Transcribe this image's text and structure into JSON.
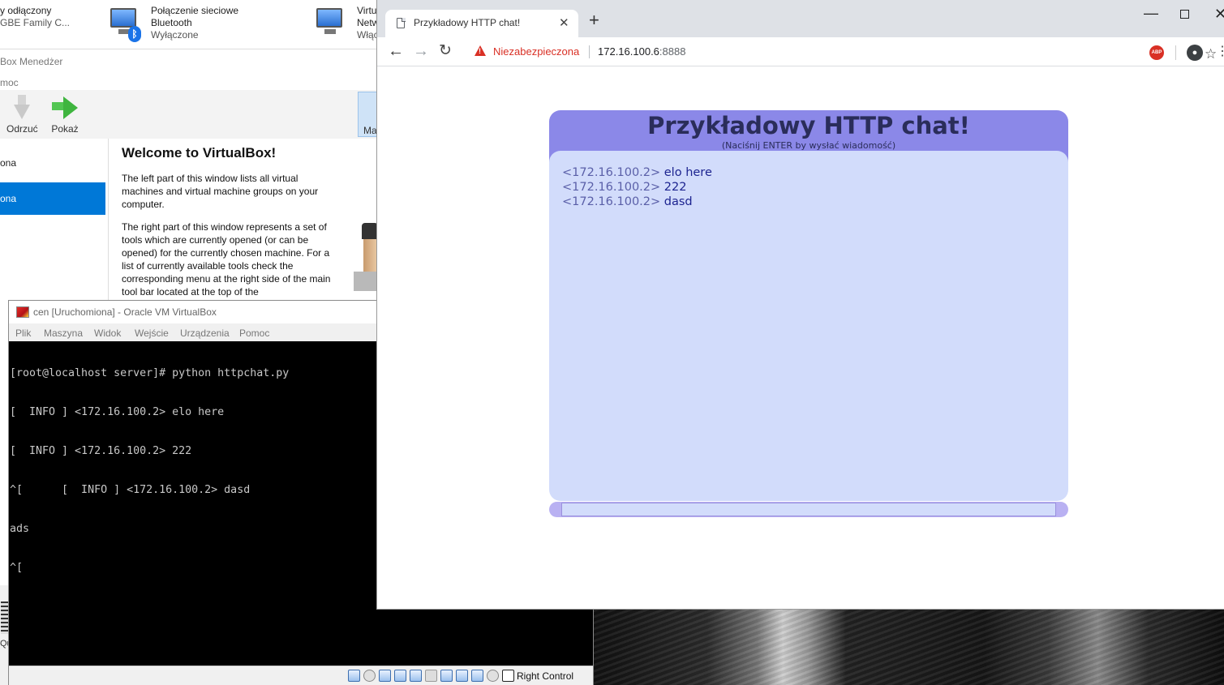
{
  "desktop": {
    "left_edge_label": "Qu"
  },
  "network_connections": {
    "items": [
      {
        "name": "y odłączony",
        "sub": "GBE Family C..."
      },
      {
        "name": "Połączenie sieciowe",
        "name2": "Bluetooth",
        "sub": "Wyłączone"
      },
      {
        "name": "Virtu",
        "name2": "Netw",
        "sub": "Włąc"
      }
    ]
  },
  "vbox_manager": {
    "title": "Box Menedżer",
    "menu_fragment": "moc",
    "toolbar": {
      "discard_label": "Odrzuć",
      "show_label": "Pokaż",
      "machine_tab": "Ma"
    },
    "vm_list": [
      {
        "label": "ona"
      },
      {
        "label": "ona"
      }
    ],
    "welcome": {
      "heading": "Welcome to VirtualBox!",
      "p1": "The left part of this window lists all virtual machines and virtual machine groups on your computer.",
      "p2": "The right part of this window represents a set of tools which are currently opened (or can be opened) for the currently chosen machine. For a list of currently available tools check the corresponding menu at the right side of the main tool bar located at the top of the"
    }
  },
  "vm_window": {
    "title": "cen [Uruchomiona] - Oracle VM VirtualBox",
    "menu": [
      "Plik",
      "Maszyna",
      "Widok",
      "Wejście",
      "Urządzenia",
      "Pomoc"
    ],
    "console_lines": [
      "[root@localhost server]# python httpchat.py",
      "[  INFO ] <172.16.100.2> elo here",
      "[  INFO ] <172.16.100.2> 222",
      "^[      [  INFO ] <172.16.100.2> dasd",
      "ads",
      "^["
    ],
    "host_key": "Right Control"
  },
  "browser": {
    "tab_title": "Przykładowy HTTP chat!",
    "tab_close": "✕",
    "new_tab": "+",
    "security_label": "Niezabezpieczona",
    "url_host": "172.16.100.6",
    "url_port": ":8888",
    "abp_label": "ABP"
  },
  "chat": {
    "title": "Przykładowy HTTP chat!",
    "hint": "(Naciśnij ENTER by wysłać wiadomość)",
    "messages": [
      {
        "who": "<172.16.100.2>",
        "text": "elo here"
      },
      {
        "who": "<172.16.100.2>",
        "text": "222"
      },
      {
        "who": "<172.16.100.2>",
        "text": "dasd"
      }
    ],
    "input_value": ""
  },
  "colors": {
    "chat_header": "#8b88e8",
    "chat_log_bg": "#d2dcfb",
    "chat_input_bar": "#b9b1f2",
    "insecure_red": "#d93025",
    "console_bg": "#000000"
  }
}
